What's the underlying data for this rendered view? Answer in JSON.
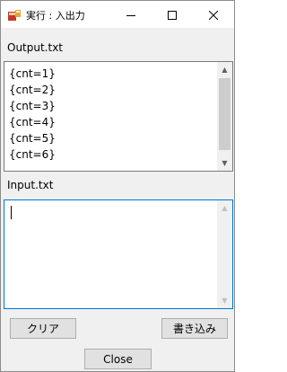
{
  "window": {
    "title": "実行 : 入出力",
    "icon": "app-icon",
    "controls": {
      "minimize": "minimize-icon",
      "maximize": "maximize-icon",
      "close": "close-icon"
    }
  },
  "output": {
    "label": "Output.txt",
    "lines": [
      "{cnt=1}",
      "{cnt=2}",
      "{cnt=3}",
      "{cnt=4}",
      "{cnt=5}",
      "{cnt=6}"
    ]
  },
  "input": {
    "label": "Input.txt",
    "value": ""
  },
  "buttons": {
    "clear": "クリア",
    "write": "書き込み",
    "close": "Close"
  },
  "colors": {
    "focus_border": "#0078d7",
    "window_bg": "#f0f0f0"
  }
}
